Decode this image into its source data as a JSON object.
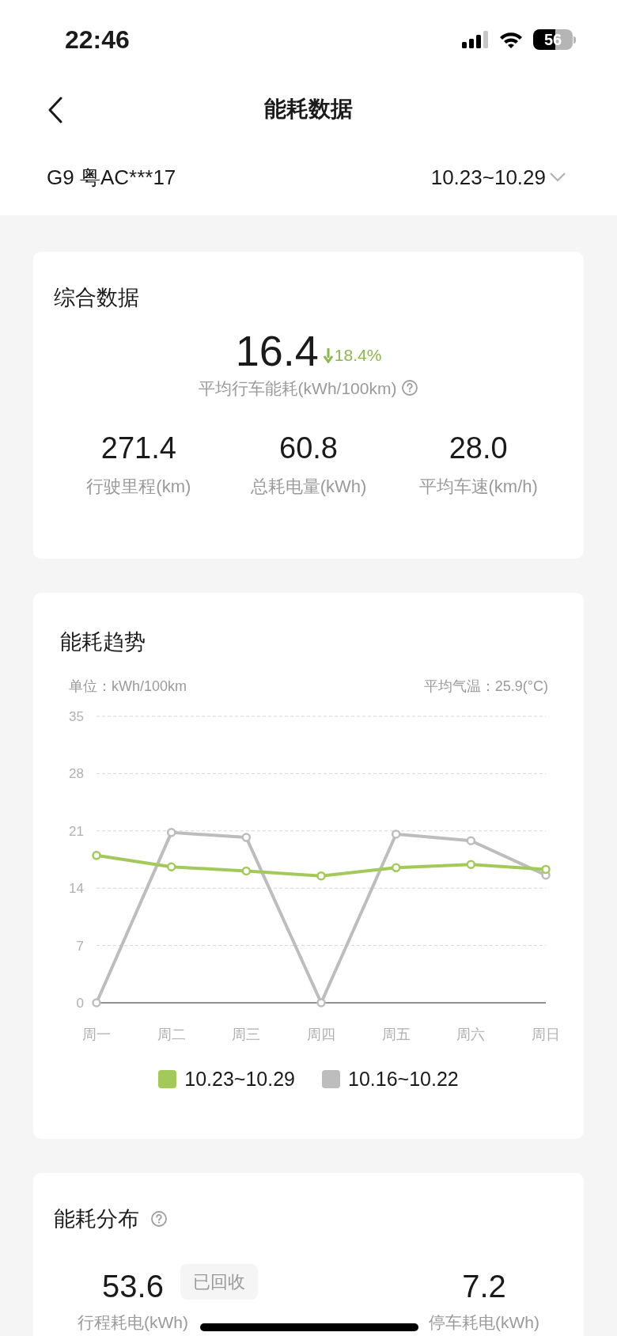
{
  "status_bar": {
    "time": "22:46",
    "battery": "56"
  },
  "nav": {
    "title": "能耗数据"
  },
  "vehicle": {
    "name": "G9 粤AC***17",
    "date_range": "10.23~10.29"
  },
  "summary": {
    "title": "综合数据",
    "main_value": "16.4",
    "change": "18.4%",
    "main_label": "平均行车能耗(kWh/100km)",
    "stats": [
      {
        "value": "271.4",
        "label": "行驶里程(km)"
      },
      {
        "value": "60.8",
        "label": "总耗电量(kWh)"
      },
      {
        "value": "28.0",
        "label": "平均车速(km/h)"
      }
    ]
  },
  "trend": {
    "title": "能耗趋势",
    "unit": "单位：kWh/100km",
    "temperature": "平均气温：25.9(°C)",
    "chart_data": {
      "type": "line",
      "categories": [
        "周一",
        "周二",
        "周三",
        "周四",
        "周五",
        "周六",
        "周日"
      ],
      "ylim": [
        0,
        35
      ],
      "grid": true,
      "yticks": [
        0,
        7,
        14,
        21,
        28,
        35
      ],
      "series": [
        {
          "name": "10.23~10.29",
          "color": "#a3c95a",
          "marker": "circle",
          "values": [
            18,
            16.6,
            16.1,
            15.5,
            16.5,
            16.9,
            16.3
          ]
        },
        {
          "name": "10.16~10.22",
          "color": "#bdbdbd",
          "marker": "circle",
          "values": [
            0,
            20.8,
            20.2,
            0,
            20.6,
            19.8,
            15.6
          ]
        }
      ]
    }
  },
  "distribution": {
    "title": "能耗分布",
    "left": {
      "value": "53.6",
      "label": "行程耗电(kWh)"
    },
    "recovered_label": "已回收",
    "right": {
      "value": "7.2",
      "label": "停车耗电(kWh)"
    }
  }
}
